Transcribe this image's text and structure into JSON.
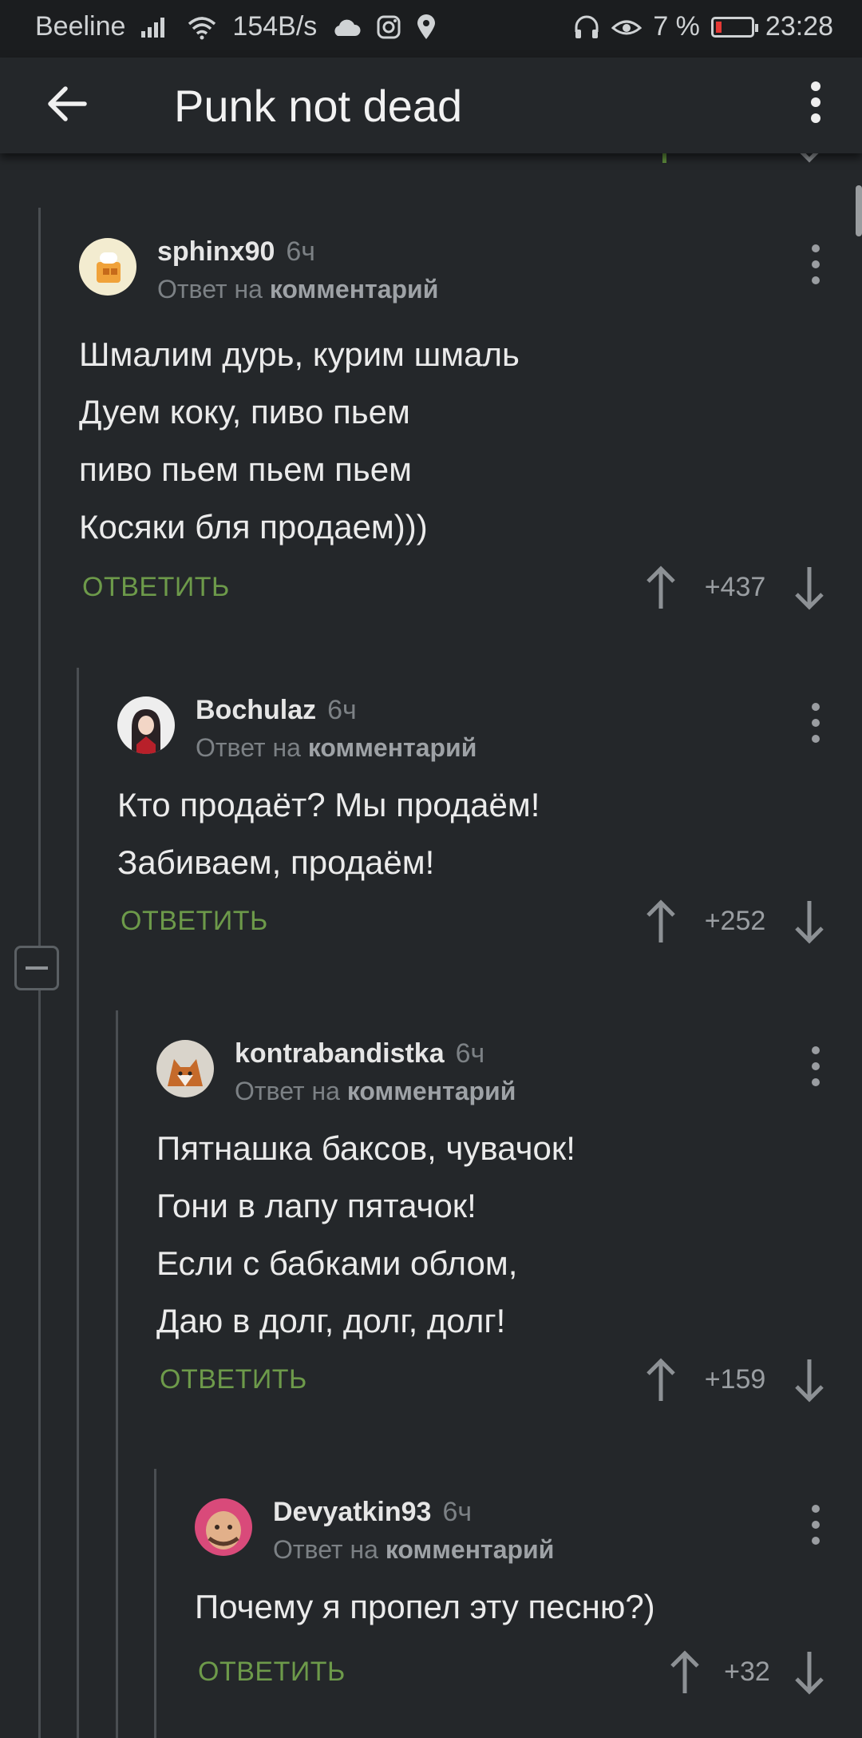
{
  "status_bar": {
    "carrier": "Beeline",
    "speed": "154B/s",
    "battery": "7 %",
    "time": "23:28"
  },
  "app_bar": {
    "title": "Punk not dead"
  },
  "colors": {
    "background": "#24272a",
    "accent_green": "#6d9a4a",
    "muted": "#7c8185"
  },
  "comments": [
    {
      "author": "sphinx90",
      "time": "6ч",
      "reply_prefix": "Ответ на",
      "reply_target": "комментарий",
      "lines": [
        "Шмалим дурь, курим шмаль",
        "Дуем коку, пиво пьем",
        "пиво пьем пьем пьем",
        "Косяки бля продаем)))"
      ],
      "reply_label": "ОТВЕТИТЬ",
      "score": "+437"
    },
    {
      "author": "Bochulaz",
      "time": "6ч",
      "reply_prefix": "Ответ на",
      "reply_target": "комментарий",
      "lines": [
        "Кто продаёт? Мы продаём!",
        "Забиваем, продаём!"
      ],
      "reply_label": "ОТВЕТИТЬ",
      "score": "+252"
    },
    {
      "author": "kontrabandistka",
      "time": "6ч",
      "reply_prefix": "Ответ на",
      "reply_target": "комментарий",
      "lines": [
        "Пятнашка баксов, чувачок!",
        "Гони в лапу пятачок!",
        "Если с бабками облом,",
        "Даю в долг, долг, долг!"
      ],
      "reply_label": "ОТВЕТИТЬ",
      "score": "+159"
    },
    {
      "author": "Devyatkin93",
      "time": "6ч",
      "reply_prefix": "Ответ на",
      "reply_target": "комментарий",
      "lines": [
        "Почему я пропел эту песню?)"
      ],
      "reply_label": "ОТВЕТИТЬ",
      "score": "+32"
    }
  ]
}
